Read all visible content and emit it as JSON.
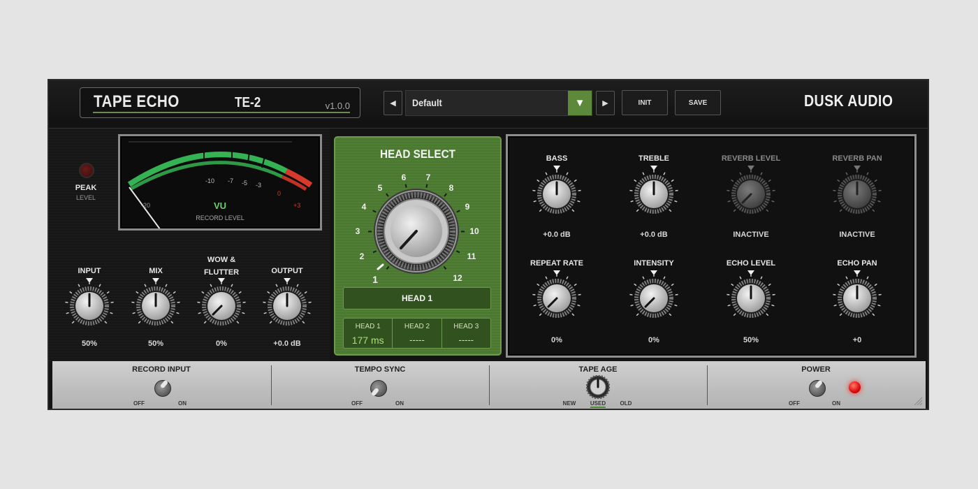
{
  "header": {
    "plugin_name": "TAPE ECHO",
    "model": "TE-2",
    "version": "v1.0.0",
    "preset": "Default",
    "prev_icon": "◀",
    "next_icon": "▶",
    "dropdown_icon": "▼",
    "init_label": "INIT",
    "save_label": "SAVE",
    "brand": "DUSK AUDIO"
  },
  "meter": {
    "peak_label": "PEAK",
    "peak_sublabel": "LEVEL",
    "scale": [
      "-20",
      "-10",
      "-7",
      "-5",
      "-3",
      "0",
      "+3"
    ],
    "title": "VU",
    "subtitle": "RECORD LEVEL"
  },
  "left_knobs": [
    {
      "label": "INPUT",
      "label2": "",
      "value": "50%",
      "level": 0.5
    },
    {
      "label": "MIX",
      "label2": "",
      "value": "50%",
      "level": 0.5
    },
    {
      "label": "WOW &",
      "label2": "FLUTTER",
      "value": "0%",
      "level": 0.0
    },
    {
      "label": "OUTPUT",
      "label2": "",
      "value": "+0.0 dB",
      "level": 0.5
    }
  ],
  "head_select": {
    "title": "HEAD SELECT",
    "numbers": [
      "1",
      "2",
      "3",
      "4",
      "5",
      "6",
      "7",
      "8",
      "9",
      "10",
      "11",
      "12"
    ],
    "selected": 1,
    "selected_label": "HEAD 1",
    "heads": [
      {
        "name": "HEAD 1",
        "value": "177 ms",
        "active": true
      },
      {
        "name": "HEAD 2",
        "value": "-----",
        "active": false
      },
      {
        "name": "HEAD 3",
        "value": "-----",
        "active": false
      }
    ]
  },
  "right_knobs": [
    {
      "label": "BASS",
      "value": "+0.0 dB",
      "level": 0.5,
      "inactive": false
    },
    {
      "label": "TREBLE",
      "value": "+0.0 dB",
      "level": 0.5,
      "inactive": false
    },
    {
      "label": "REVERB LEVEL",
      "value": "INACTIVE",
      "level": 0.0,
      "inactive": true
    },
    {
      "label": "REVERB PAN",
      "value": "INACTIVE",
      "level": 0.5,
      "inactive": true
    },
    {
      "label": "REPEAT RATE",
      "value": "0%",
      "level": 0.0,
      "inactive": false
    },
    {
      "label": "INTENSITY",
      "value": "0%",
      "level": 0.0,
      "inactive": false
    },
    {
      "label": "ECHO LEVEL",
      "value": "50%",
      "level": 0.5,
      "inactive": false
    },
    {
      "label": "ECHO PAN",
      "value": "+0",
      "level": 0.5,
      "inactive": false
    }
  ],
  "bottom": {
    "record_input": {
      "label": "RECORD INPUT",
      "off": "OFF",
      "on": "ON",
      "state": "on"
    },
    "tempo_sync": {
      "label": "TEMPO SYNC",
      "off": "OFF",
      "on": "ON",
      "state": "off"
    },
    "tape_age": {
      "label": "TAPE AGE",
      "options": [
        "NEW",
        "USED",
        "OLD"
      ],
      "selected": "USED"
    },
    "power": {
      "label": "POWER",
      "off": "OFF",
      "on": "ON",
      "state": "on"
    }
  },
  "colors": {
    "accent_green": "#5d8a3a",
    "meter_green": "#35b254",
    "meter_red": "#d63a2a",
    "power_led": "#ff2a2a"
  }
}
